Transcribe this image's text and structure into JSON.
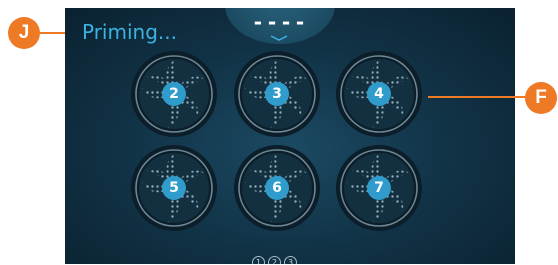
{
  "screen": {
    "status_text": "Priming...",
    "readout": "----"
  },
  "pumps": [
    {
      "label": "2"
    },
    {
      "label": "3"
    },
    {
      "label": "4"
    },
    {
      "label": "5"
    },
    {
      "label": "6"
    },
    {
      "label": "7"
    }
  ],
  "pagination": [
    "1",
    "2",
    "3"
  ],
  "callouts": {
    "left": "J",
    "right": "F"
  },
  "colors": {
    "accent_blue": "#3bb3e0",
    "callout_orange": "#ef7a26",
    "screen_background": "#123549"
  },
  "icons": {
    "pump": "pump-fan-icon",
    "chevron": "chevron-down-icon"
  }
}
